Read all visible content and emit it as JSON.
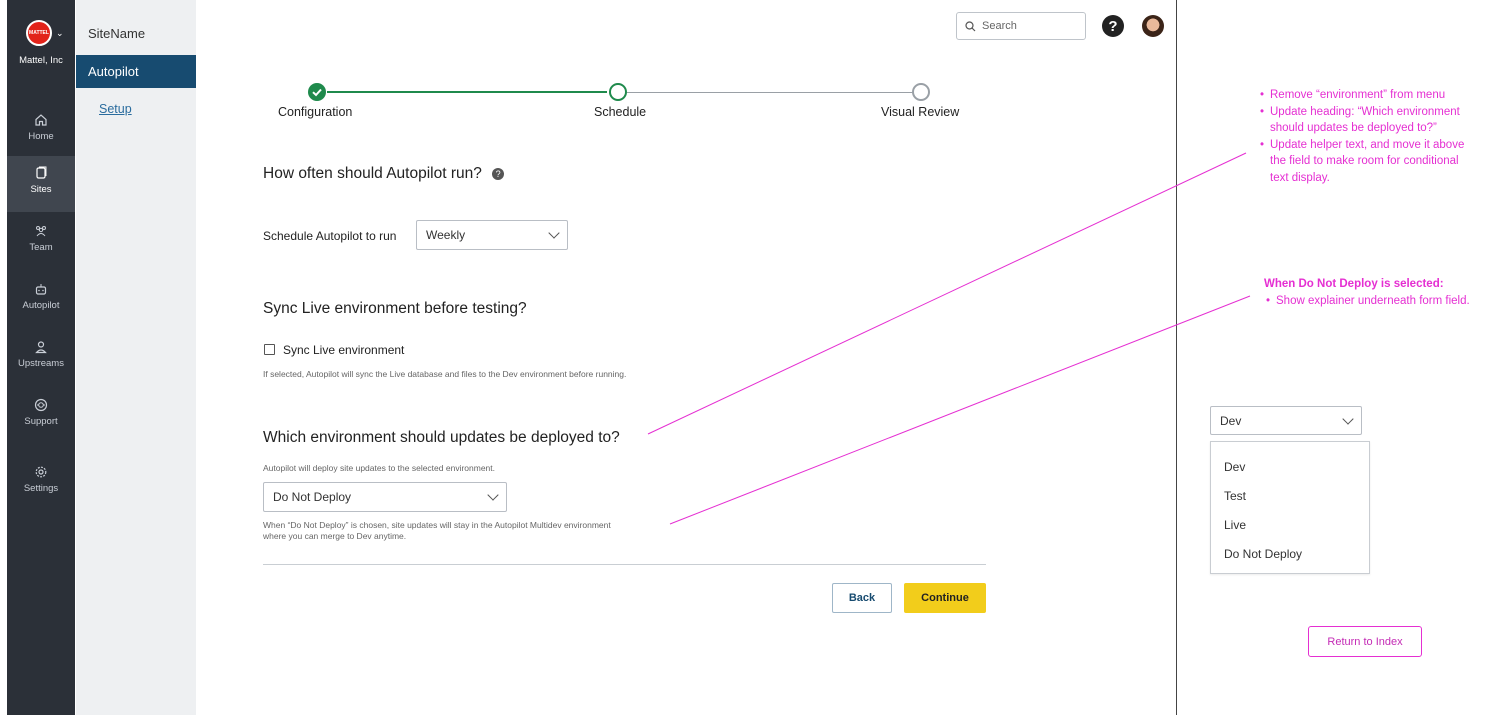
{
  "org": {
    "name": "Mattel, Inc",
    "logo_text": "MATTEL"
  },
  "rail": {
    "items": [
      {
        "label": "Home",
        "icon": "home-icon"
      },
      {
        "label": "Sites",
        "icon": "sites-icon",
        "active": true
      },
      {
        "label": "Team",
        "icon": "team-icon"
      },
      {
        "label": "Autopilot",
        "icon": "robot-icon"
      },
      {
        "label": "Upstreams",
        "icon": "person-icon"
      },
      {
        "label": "Support",
        "icon": "lifebuoy-icon"
      },
      {
        "label": "Settings",
        "icon": "gear-icon"
      }
    ]
  },
  "subnav": {
    "site_name": "SiteName",
    "active_tab": "Autopilot",
    "link": "Setup"
  },
  "topbar": {
    "search_placeholder": "Search"
  },
  "stepper": {
    "steps": [
      {
        "label": "Configuration",
        "state": "complete"
      },
      {
        "label": "Schedule",
        "state": "current"
      },
      {
        "label": "Visual Review",
        "state": "upcoming"
      }
    ],
    "colors": {
      "complete": "#1f8a4c",
      "upcoming": "#9aa0a6"
    }
  },
  "section_run": {
    "heading": "How often should Autopilot run?",
    "label": "Schedule Autopilot to run",
    "value": "Weekly"
  },
  "section_sync": {
    "heading": "Sync Live environment before testing?",
    "checkbox_label": "Sync Live environment",
    "help": "If selected, Autopilot will sync the Live database and files to the Dev environment before running."
  },
  "section_deploy": {
    "heading": "Which environment should updates be deployed to?",
    "helper": "Autopilot will deploy site updates to the selected environment.",
    "value": "Do Not Deploy",
    "explainer_line1": "When “Do Not Deploy” is chosen, site updates will stay in the Autopilot Multidev environment",
    "explainer_line2": "where you can merge to Dev anytime."
  },
  "actions": {
    "back": "Back",
    "continue": "Continue"
  },
  "annotations": {
    "color": "#e52fd2",
    "note1": [
      "Remove “environment” from menu",
      "Update heading: “Which environment",
      "should updates be deployed to?”",
      "Update helper text, and move it above",
      "the field to make room for conditional",
      "text display."
    ],
    "note2_title": "When Do Not Deploy is selected:",
    "note2_item": "Show explainer underneath form field.",
    "dropdown_value": "Dev",
    "dropdown_options": [
      "Dev",
      "Test",
      "Live",
      "Do Not Deploy"
    ],
    "return_button": "Return to Index"
  }
}
